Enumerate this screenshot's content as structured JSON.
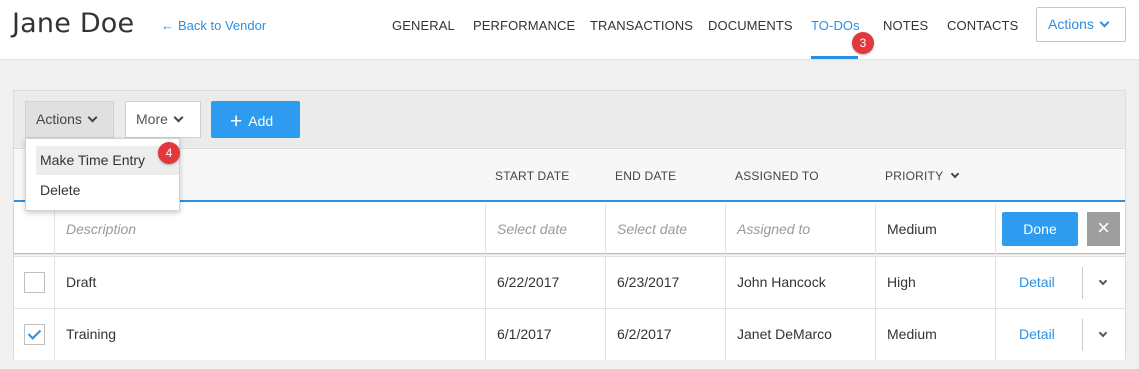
{
  "header": {
    "title": "Jane Doe",
    "back_link": "Back to Vendor",
    "back_arrow": "←",
    "tabs": [
      {
        "label": "GENERAL"
      },
      {
        "label": "PERFORMANCE"
      },
      {
        "label": "TRANSACTIONS"
      },
      {
        "label": "DOCUMENTS"
      },
      {
        "label": "TO-DOs"
      },
      {
        "label": "NOTES"
      },
      {
        "label": "CONTACTS"
      }
    ],
    "active_tab": "TO-DOs",
    "actions_label": "Actions"
  },
  "badges": {
    "tab_badge": "3",
    "menu_badge": "4"
  },
  "toolbar": {
    "actions_label": "Actions",
    "more_label": "More",
    "add_label": "Add",
    "add_icon": "+"
  },
  "actions_menu": {
    "items": [
      {
        "label": "Make Time Entry"
      },
      {
        "label": "Delete"
      }
    ]
  },
  "table": {
    "columns": [
      "START DATE",
      "END DATE",
      "ASSIGNED TO",
      "PRIORITY"
    ],
    "new_row": {
      "description_placeholder": "Description",
      "start_placeholder": "Select date",
      "end_placeholder": "Select date",
      "assigned_placeholder": "Assigned to",
      "priority": "Medium",
      "done_label": "Done",
      "close_icon": "×"
    },
    "rows": [
      {
        "checked": false,
        "description": "Draft",
        "start": "6/22/2017",
        "end": "6/23/2017",
        "assigned": "John Hancock",
        "priority": "High",
        "detail": "Detail"
      },
      {
        "checked": true,
        "description": "Training",
        "start": "6/1/2017",
        "end": "6/2/2017",
        "assigned": "Janet DeMarco",
        "priority": "Medium",
        "detail": "Detail"
      }
    ]
  },
  "colors": {
    "accent": "#2d8fe0",
    "badge": "#e2373d",
    "button": "#2d9cf0"
  }
}
